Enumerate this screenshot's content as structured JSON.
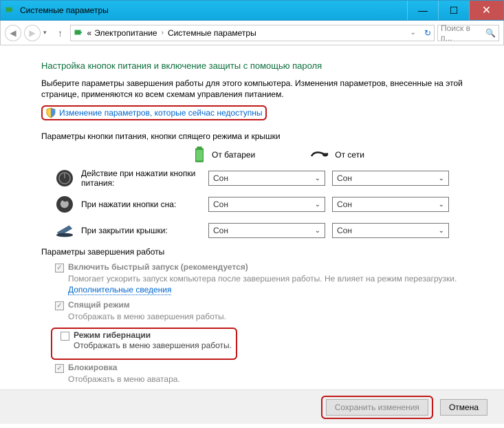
{
  "window": {
    "title": "Системные параметры"
  },
  "breadcrumb": {
    "a": "Электропитание",
    "b": "Системные параметры"
  },
  "search": {
    "placeholder": "Поиск в п..."
  },
  "heading": "Настройка кнопок питания и включение защиты с помощью пароля",
  "desc": "Выберите параметры завершения работы для этого компьютера. Изменения параметров, внесенные на этой странице, применяются ко всем схемам управления питанием.",
  "admin_link": "Изменение параметров, которые сейчас недоступны",
  "section_a": "Параметры кнопки питания, кнопки спящего режима и крышки",
  "sources": {
    "battery": "От батареи",
    "ac": "От сети"
  },
  "rows": {
    "power": {
      "label": "Действие при нажатии кнопки питания:",
      "b": "Сон",
      "a": "Сон"
    },
    "sleep": {
      "label": "При нажатии кнопки сна:",
      "b": "Сон",
      "a": "Сон"
    },
    "lid": {
      "label": "При закрытии крышки:",
      "b": "Сон",
      "a": "Сон"
    }
  },
  "section_b": "Параметры завершения работы",
  "shut": {
    "fast": {
      "label": "Включить быстрый запуск (рекомендуется)",
      "sub1": "Помогает ускорить запуск компьютера после завершения работы. Не влияет на режим перезагрузки. ",
      "more": "Дополнительные сведения"
    },
    "sleep": {
      "label": "Спящий режим",
      "sub": "Отображать в меню завершения работы."
    },
    "hiber": {
      "label": "Режим гибернации",
      "sub": "Отображать в меню завершения работы."
    },
    "lock": {
      "label": "Блокировка",
      "sub": "Отображать в меню аватара."
    }
  },
  "buttons": {
    "save": "Сохранить изменения",
    "cancel": "Отмена"
  }
}
